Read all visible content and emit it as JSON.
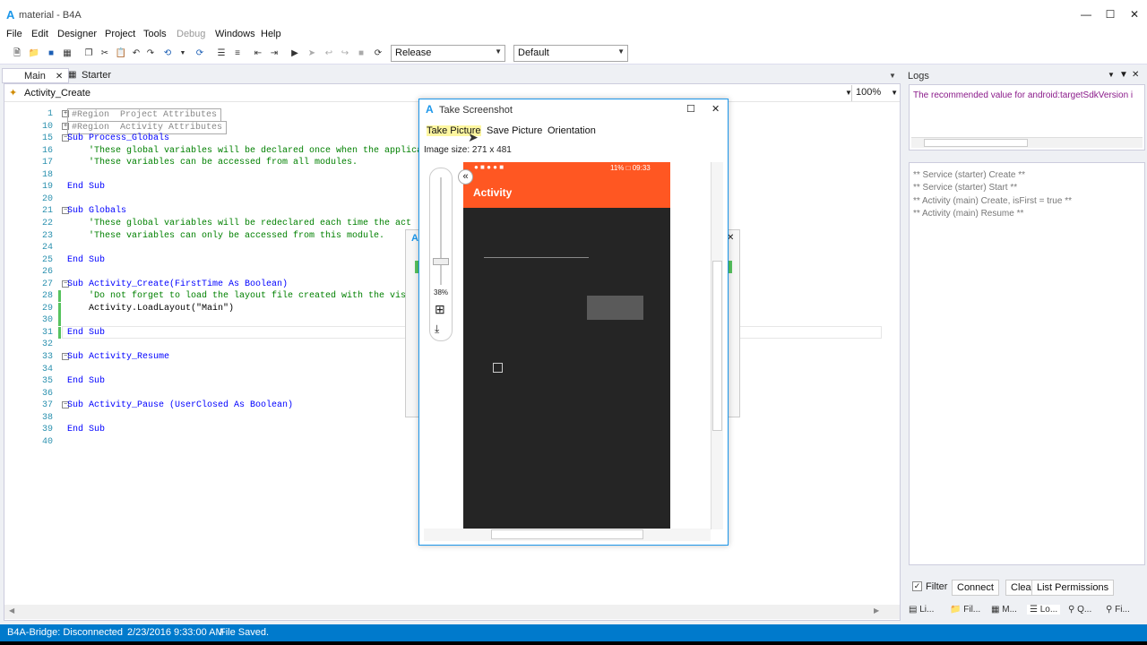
{
  "window": {
    "title": "material - B4A"
  },
  "menu": [
    "File",
    "Edit",
    "Designer",
    "Project",
    "Tools",
    "Debug",
    "Windows",
    "Help"
  ],
  "toolbar": {
    "build_config": "Release",
    "device": "Default"
  },
  "tabs": [
    {
      "label": "Main"
    },
    {
      "label": "Starter"
    }
  ],
  "editor": {
    "sub_selector": "Activity_Create",
    "zoom": "100%",
    "lines": [
      {
        "n": "1",
        "t": "#Region  Project Attributes",
        "k": "region"
      },
      {
        "n": "10",
        "t": "#Region  Activity Attributes",
        "k": "region"
      },
      {
        "n": "15",
        "t": "Sub Process_Globals",
        "k": "sub"
      },
      {
        "n": "16",
        "t": "    'These global variables will be declared once when the applica",
        "k": "cm"
      },
      {
        "n": "17",
        "t": "    'These variables can be accessed from all modules.",
        "k": "cm"
      },
      {
        "n": "18",
        "t": "",
        "k": ""
      },
      {
        "n": "19",
        "t": "End Sub",
        "k": "end"
      },
      {
        "n": "20",
        "t": "",
        "k": ""
      },
      {
        "n": "21",
        "t": "Sub Globals",
        "k": "sub"
      },
      {
        "n": "22",
        "t": "    'These global variables will be redeclared each time the act",
        "k": "cm"
      },
      {
        "n": "23",
        "t": "    'These variables can only be accessed from this module.",
        "k": "cm"
      },
      {
        "n": "24",
        "t": "",
        "k": ""
      },
      {
        "n": "25",
        "t": "End Sub",
        "k": "end"
      },
      {
        "n": "26",
        "t": "",
        "k": ""
      },
      {
        "n": "27",
        "t": "Sub Activity_Create(FirstTime As Boolean)",
        "k": "sub"
      },
      {
        "n": "28",
        "t": "    'Do not forget to load the layout file created with the visu",
        "k": "cm"
      },
      {
        "n": "29",
        "t": "    Activity.LoadLayout(\"Main\")",
        "k": "code"
      },
      {
        "n": "30",
        "t": "",
        "k": ""
      },
      {
        "n": "31",
        "t": "End Sub",
        "k": "end"
      },
      {
        "n": "32",
        "t": "",
        "k": ""
      },
      {
        "n": "33",
        "t": "Sub Activity_Resume",
        "k": "sub"
      },
      {
        "n": "34",
        "t": "",
        "k": ""
      },
      {
        "n": "35",
        "t": "End Sub",
        "k": "end"
      },
      {
        "n": "36",
        "t": "",
        "k": ""
      },
      {
        "n": "37",
        "t": "Sub Activity_Pause (UserClosed As Boolean)",
        "k": "sub"
      },
      {
        "n": "38",
        "t": "",
        "k": ""
      },
      {
        "n": "39",
        "t": "End Sub",
        "k": "end"
      },
      {
        "n": "40",
        "t": "",
        "k": ""
      }
    ]
  },
  "dialog": {
    "title": "Take Screenshot",
    "menu": [
      "Take Picture",
      "Save Picture",
      "Orientation"
    ],
    "image_size": "Image size: 271 x 481",
    "zoom_label": "38%",
    "zoom_fraction": 0.38,
    "phone": {
      "status": "11% □ 09:33",
      "app_title": "Activity"
    }
  },
  "logs": {
    "title": "Logs",
    "warning": "The recommended value for android:targetSdkVersion i",
    "lines": [
      "** Service (starter) Create **",
      "** Service (starter) Start **",
      "** Activity (main) Create, isFirst = true **",
      "** Activity (main) Resume **"
    ],
    "filter_label": "Filter",
    "filter_checked": true,
    "buttons": [
      "Connect",
      "Clear",
      "List Permissions"
    ],
    "bottom_tabs": [
      "Li...",
      "Fil...",
      "M...",
      "Lo...",
      "Q...",
      "Fi..."
    ]
  },
  "statusbar": {
    "bridge": "B4A-Bridge: Disconnected",
    "time": "2/23/2016 9:33:00 AM",
    "message": "File Saved."
  },
  "colors": {
    "accent": "#1c97ea",
    "status": "#007acc",
    "android_primary": "#ff5722"
  }
}
